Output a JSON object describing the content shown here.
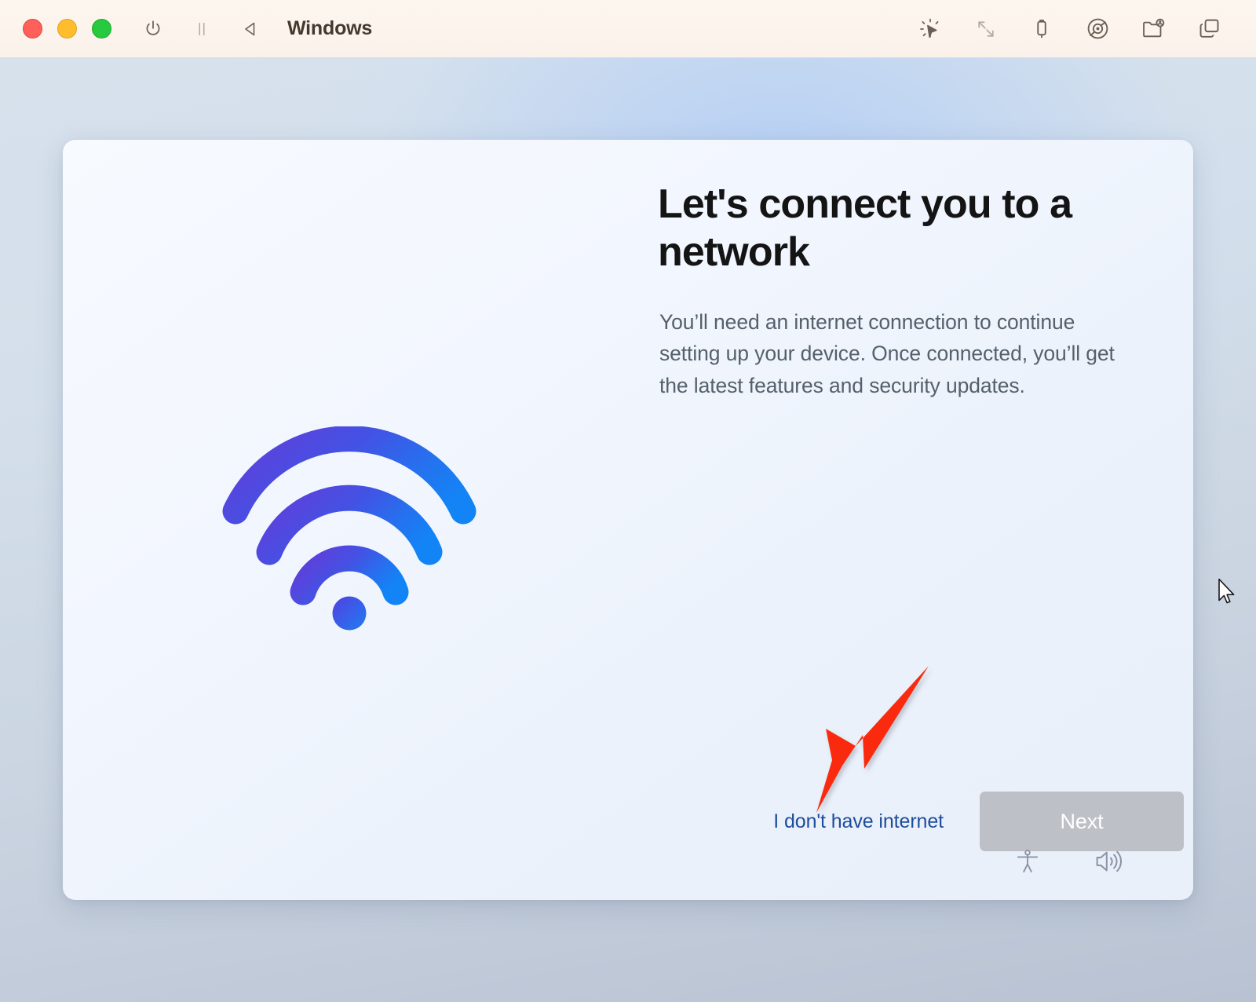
{
  "window": {
    "title": "Windows",
    "traffic_lights": [
      {
        "name": "close",
        "color": "#ff6059"
      },
      {
        "name": "minimize",
        "color": "#ffbd2e"
      },
      {
        "name": "maximize",
        "color": "#27c93f"
      }
    ],
    "left_toolbar": [
      {
        "icon": "power-icon",
        "label": "Power"
      },
      {
        "icon": "pause-icon",
        "label": "Pause"
      },
      {
        "icon": "back-triangle-icon",
        "label": "Back"
      }
    ],
    "right_toolbar": [
      {
        "icon": "cursor-click-icon",
        "label": "Pointer"
      },
      {
        "icon": "resize-diagonal-icon",
        "label": "Scale"
      },
      {
        "icon": "usb-drive-icon",
        "label": "USB"
      },
      {
        "icon": "disc-icon",
        "label": "CD / DVD"
      },
      {
        "icon": "shared-folder-icon",
        "label": "Shared folders"
      },
      {
        "icon": "windows-stack-icon",
        "label": "Windows"
      }
    ]
  },
  "oobe": {
    "illustration": {
      "icon": "wifi-icon",
      "gradient_from": "#5b4fe0",
      "gradient_to": "#1b7ef0"
    },
    "heading": "Let's connect you to a network",
    "body": "You’ll need an internet connection to continue setting up your device. Once connected, you’ll get the latest features and security updates.",
    "link_label": "I don't have internet",
    "link_color": "#1d4d9c",
    "next_label": "Next",
    "next_enabled": false,
    "next_color": "#bdc0c6",
    "system_icons": [
      {
        "icon": "accessibility-icon",
        "label": "Accessibility"
      },
      {
        "icon": "volume-icon",
        "label": "Volume"
      }
    ]
  },
  "annotation": {
    "type": "arrow",
    "color": "#f92b08",
    "points_to": "I don't have internet"
  },
  "cursor": {
    "type": "arrow-pointer"
  }
}
